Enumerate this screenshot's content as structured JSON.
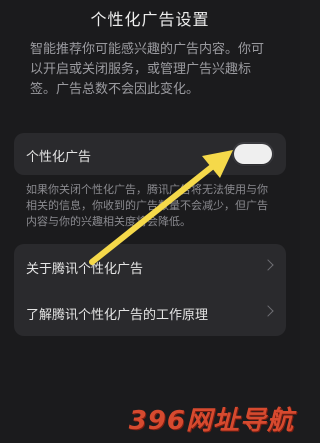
{
  "page": {
    "title": "个性化广告设置",
    "intro": "智能推荐你可能感兴趣的广告内容。你可以开启或关闭服务，或管理广告兴趣标签。广告总数不会因此变化。"
  },
  "toggle": {
    "label": "个性化广告",
    "enabled": false
  },
  "note": "如果你关闭个性化广告，腾讯广告将无法使用与你相关的信息，你收到的广告数量不会减少，但广告内容与你的兴趣相关度将会降低。",
  "links": [
    {
      "label": "关于腾讯个性化广告"
    },
    {
      "label": "了解腾讯个性化广告的工作原理"
    }
  ],
  "watermark": "396网址导航",
  "colors": {
    "background": "#1b1b1d",
    "card": "#2a2a2d",
    "arrow": "#f5d94a",
    "watermark": "#d64a2f"
  },
  "icons": [
    "chevron-right-icon",
    "annotation-arrow"
  ]
}
